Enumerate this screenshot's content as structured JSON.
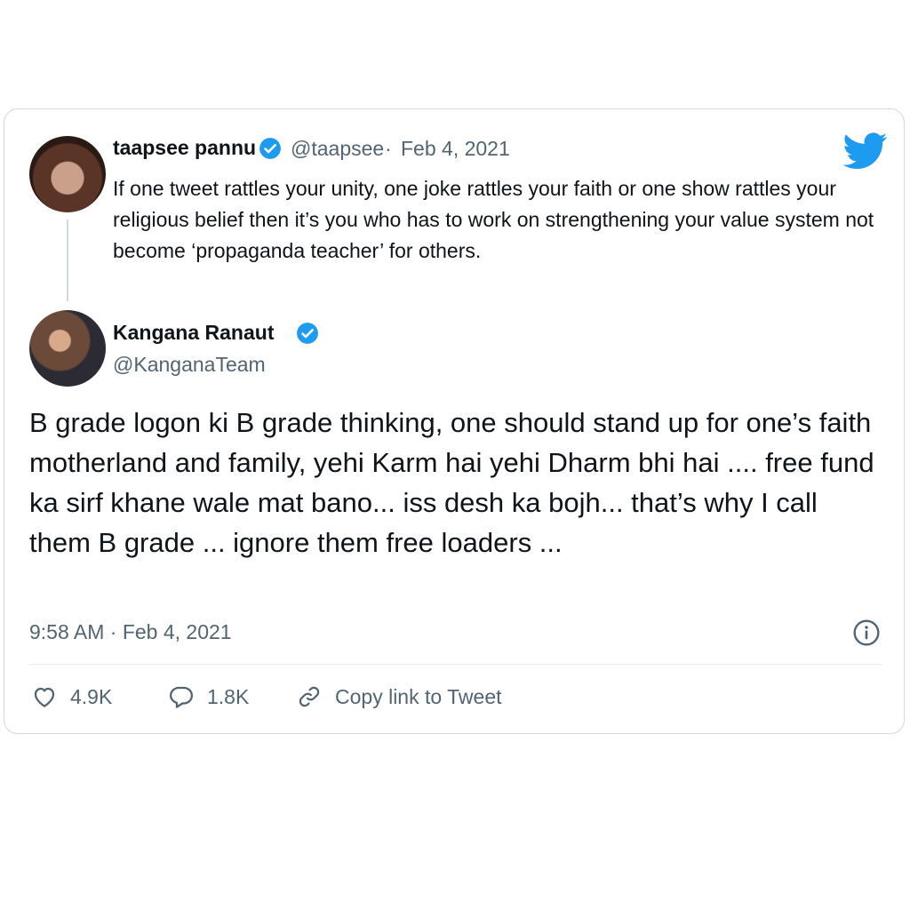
{
  "quoted_tweet": {
    "display_name": "taapsee pannu",
    "handle": "@taapsee",
    "separator": "·",
    "date": "Feb 4, 2021",
    "text": "If one tweet rattles your unity, one joke rattles your faith or one show rattles your religious belief then it’s you who has to work on strengthening your value system not become ‘propaganda teacher’ for others."
  },
  "tweet": {
    "display_name": "Kangana Ranaut",
    "handle": "@KanganaTeam",
    "text": "B grade logon ki B grade thinking, one should stand up for one’s faith motherland and family, yehi Karm hai yehi Dharm bhi hai .... free fund ka sirf khane wale mat bano... iss desh ka bojh... that’s why I call them B grade ... ignore them free loaders ...",
    "timestamp": "9:58 AM · Feb 4, 2021"
  },
  "actions": {
    "likes": "4.9K",
    "replies": "1.8K",
    "copy_link_label": "Copy link to Tweet"
  },
  "icons": {
    "brand": "twitter-bird-icon",
    "verified": "verified-badge-icon",
    "info": "info-icon",
    "like": "heart-icon",
    "reply": "speech-bubble-icon",
    "link": "link-icon"
  },
  "colors": {
    "twitter_blue": "#1d9bf0",
    "text": "#0f1419",
    "muted": "#536471",
    "border": "#cfd9de"
  }
}
